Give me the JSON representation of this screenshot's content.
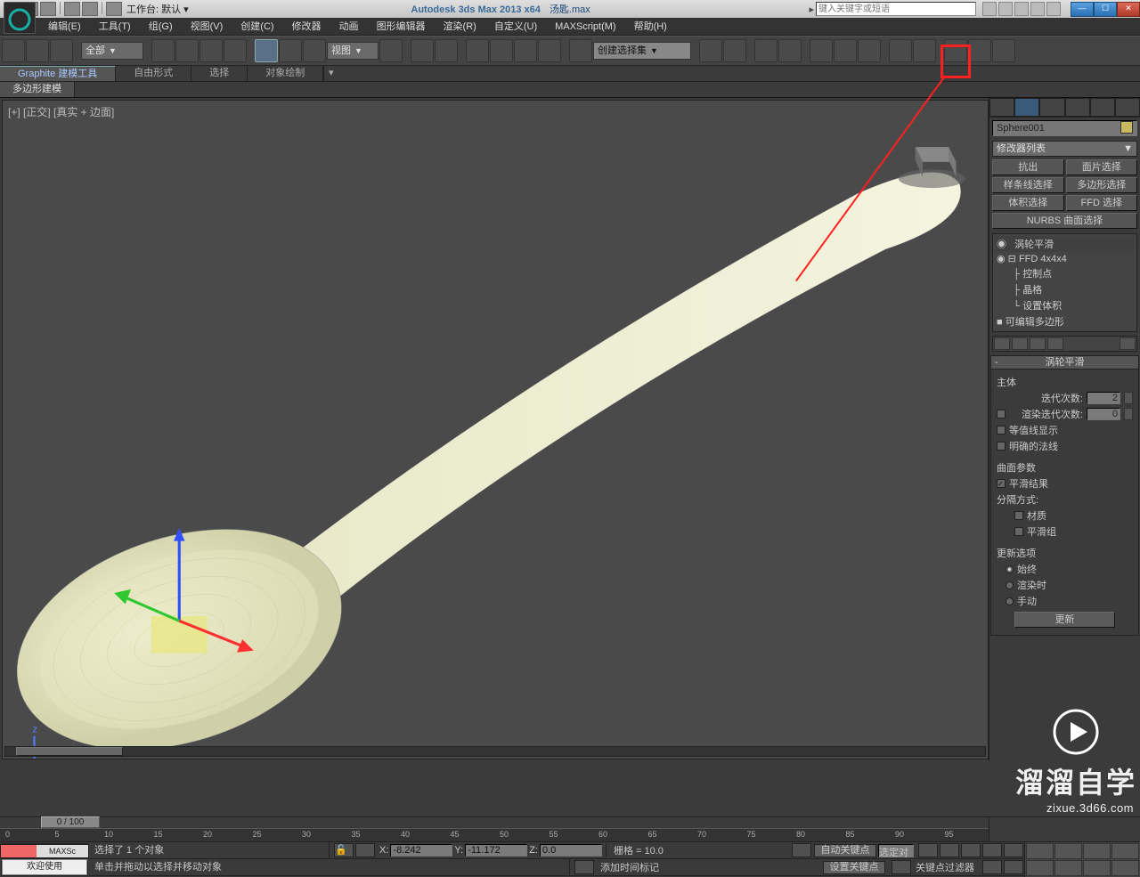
{
  "titlebar": {
    "workspace_label": "工作台: 默认",
    "app_title": "Autodesk 3ds Max  2013 x64",
    "filename": "汤匙.max",
    "search_placeholder": "键入关键字或短语",
    "arrow": "▸"
  },
  "menus": [
    "编辑(E)",
    "工具(T)",
    "组(G)",
    "视图(V)",
    "创建(C)",
    "修改器",
    "动画",
    "图形编辑器",
    "渲染(R)",
    "自定义(U)",
    "MAXScript(M)",
    "帮助(H)"
  ],
  "maintoolbar": {
    "all_filter": "全部",
    "view_drop": "视图",
    "named_set": "创建选择集"
  },
  "ribbon": {
    "tabs": [
      "Graphite 建模工具",
      "自由形式",
      "选择",
      "对象绘制"
    ],
    "dropdown": "▾",
    "subitem": "多边形建模"
  },
  "viewport": {
    "label": "[+] [正交] [真实 + 边面]"
  },
  "cmdpanel": {
    "object_name": "Sphere001",
    "modifier_list": "修改器列表",
    "buttons_row1": [
      "抗出",
      "面片选择"
    ],
    "buttons_row2": [
      "样条线选择",
      "多边形选择"
    ],
    "buttons_row3": [
      "体积选择",
      "FFD 选择"
    ],
    "buttons_row4_single": "NURBS 曲面选择",
    "stack": {
      "turbosmooth": "涡轮平滑",
      "ffd": "FFD 4x4x4",
      "ffd_sub": [
        "控制点",
        "晶格",
        "设置体积"
      ],
      "editable_poly": "可编辑多边形"
    },
    "rollout": {
      "title": "涡轮平滑",
      "main_body": "主体",
      "iterations_label": "迭代次数:",
      "iterations_value": "2",
      "render_iter_label": "渲染迭代次数:",
      "render_iter_value": "0",
      "isoline": "等值线显示",
      "normals": "明确的法线",
      "surface_params": "曲面参数",
      "smooth_result": "平滑结果",
      "sep_by": "分隔方式:",
      "sep_mat": "材质",
      "sep_smg": "平滑组",
      "update_opts": "更新选项",
      "upd_always": "始终",
      "upd_render": "渲染时",
      "upd_manual": "手动",
      "update_btn": "更新"
    }
  },
  "timeline": {
    "knob": "0 / 100",
    "ticks": [
      0,
      5,
      10,
      15,
      20,
      25,
      30,
      35,
      40,
      45,
      50,
      55,
      60,
      65,
      70,
      75,
      80,
      85,
      90,
      95
    ]
  },
  "status": {
    "sel": "选择了 1 个对象",
    "help": "单击并拖动以选择并移动对象",
    "x_label": "X:",
    "x": "-8.242",
    "y_label": "Y:",
    "y": "-11.172",
    "z_label": "Z:",
    "z": "0.0",
    "grid": "栅格 = 10.0",
    "add_time": "添加时间标记",
    "auto_key": "自动关键点",
    "set_key": "设置关键点",
    "sel_filter": "选定对",
    "key_filter": "关键点过滤器"
  },
  "welcome": "欢迎使用",
  "maxscript_label": "MAXSc",
  "watermark": {
    "big": "溜溜自学",
    "site": "zixue.3d66.com"
  }
}
